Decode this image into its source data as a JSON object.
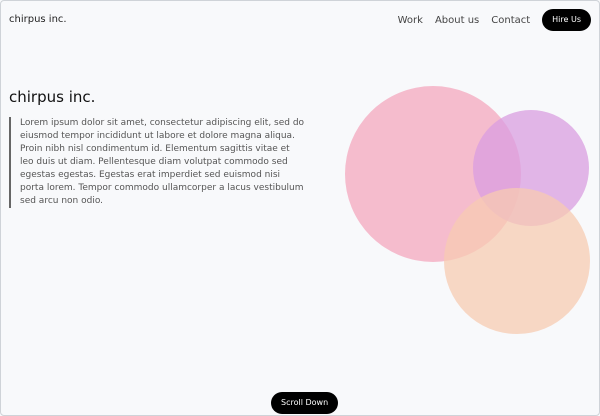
{
  "header": {
    "brand": "chirpus inc.",
    "nav": [
      "Work",
      "About us",
      "Contact"
    ],
    "cta": "Hire Us"
  },
  "hero": {
    "title": "chirpus inc.",
    "body": "Lorem ipsum dolor sit amet, consectetur adipiscing elit, sed do eiusmod tempor incididunt ut labore et dolore magna aliqua. Proin nibh nisl condimentum id. Elementum sagittis vitae et leo duis ut diam. Pellentesque diam volutpat commodo sed egestas egestas. Egestas erat imperdiet sed euismod nisi porta lorem. Tempor commodo ullamcorper a lacus vestibulum sed arcu non odio."
  },
  "decor": {
    "circle_colors": [
      "#f4a7bd",
      "#d99ee0",
      "#f7cbb2"
    ]
  },
  "footer": {
    "scroll_label": "Scroll Down"
  }
}
